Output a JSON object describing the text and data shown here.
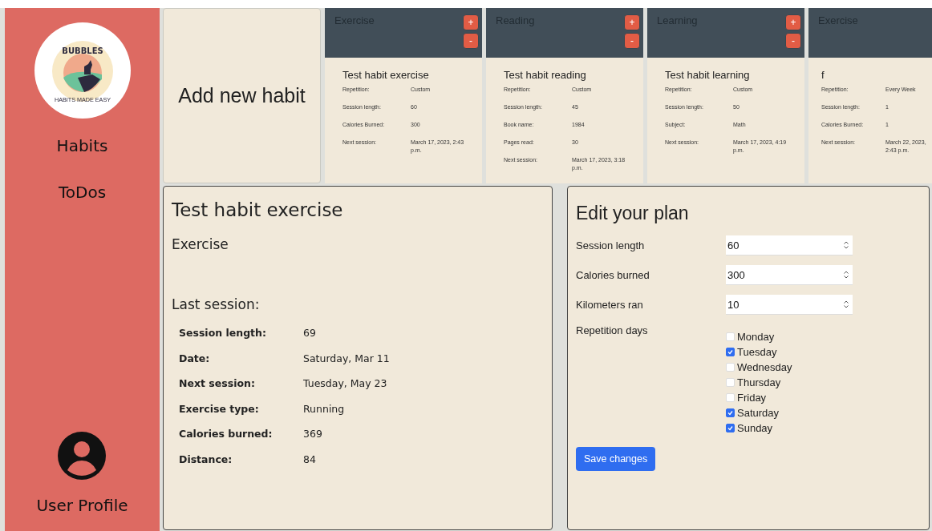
{
  "sidebar": {
    "logo": {
      "name": "BUBBLES",
      "tagline": "HABITS MADE EASY"
    },
    "items": [
      {
        "label": "Habits"
      },
      {
        "label": "ToDos"
      }
    ],
    "profile": {
      "label": "User Profile"
    }
  },
  "add_card": {
    "label": "Add new habit"
  },
  "habit_cards": [
    {
      "category": "Exercise",
      "buttons": [
        "+",
        "-"
      ],
      "name": "Test habit exercise",
      "fields": [
        {
          "label": "Repetition:",
          "value": "Custom"
        },
        {
          "label": "Session length:",
          "value": "60"
        },
        {
          "label": "Calories Burned:",
          "value": "300"
        },
        {
          "label": "Next session:",
          "value": "March 17, 2023, 2:43 p.m."
        }
      ]
    },
    {
      "category": "Reading",
      "buttons": [
        "+",
        "-"
      ],
      "name": "Test habit reading",
      "fields": [
        {
          "label": "Repetition:",
          "value": "Custom"
        },
        {
          "label": "Session length:",
          "value": "45"
        },
        {
          "label": "Book name:",
          "value": "1984"
        },
        {
          "label": "Pages read:",
          "value": "30"
        },
        {
          "label": "Next session:",
          "value": "March 17, 2023, 3:18 p.m."
        }
      ]
    },
    {
      "category": "Learning",
      "buttons": [
        "+",
        "-"
      ],
      "name": "Test habit learning",
      "fields": [
        {
          "label": "Repetition:",
          "value": "Custom"
        },
        {
          "label": "Session length:",
          "value": "50"
        },
        {
          "label": "Subject:",
          "value": "Math"
        },
        {
          "label": "Next session:",
          "value": "March 17, 2023, 4:19 p.m."
        }
      ]
    },
    {
      "category": "Exercise",
      "name": "f",
      "fields": [
        {
          "label": "Repetition:",
          "value": "Every Week"
        },
        {
          "label": "Session length:",
          "value": "1"
        },
        {
          "label": "Calories Burned:",
          "value": "1"
        },
        {
          "label": "Next session:",
          "value": "March 22, 2023, 2:43 p.m."
        }
      ]
    }
  ],
  "detail": {
    "title": "Test habit exercise",
    "category": "Exercise",
    "section": "Last session:",
    "rows": [
      {
        "label": "Session length:",
        "value": "69"
      },
      {
        "label": "Date:",
        "value": "Saturday, Mar 11"
      },
      {
        "label": "Next session:",
        "value": "Tuesday, May 23"
      },
      {
        "label": "Exercise type:",
        "value": "Running"
      },
      {
        "label": "Calories burned:",
        "value": "369"
      },
      {
        "label": "Distance:",
        "value": "84"
      }
    ]
  },
  "edit": {
    "title": "Edit your plan",
    "fields": [
      {
        "label": "Session length",
        "value": "60"
      },
      {
        "label": "Calories burned",
        "value": "300"
      },
      {
        "label": "Kilometers ran",
        "value": "10"
      }
    ],
    "days_label": "Repetition days",
    "days": [
      {
        "label": "Monday",
        "checked": false
      },
      {
        "label": "Tuesday",
        "checked": true
      },
      {
        "label": "Wednesday",
        "checked": false
      },
      {
        "label": "Thursday",
        "checked": false
      },
      {
        "label": "Friday",
        "checked": false
      },
      {
        "label": "Saturday",
        "checked": true
      },
      {
        "label": "Sunday",
        "checked": true
      }
    ],
    "button": "Save changes"
  }
}
